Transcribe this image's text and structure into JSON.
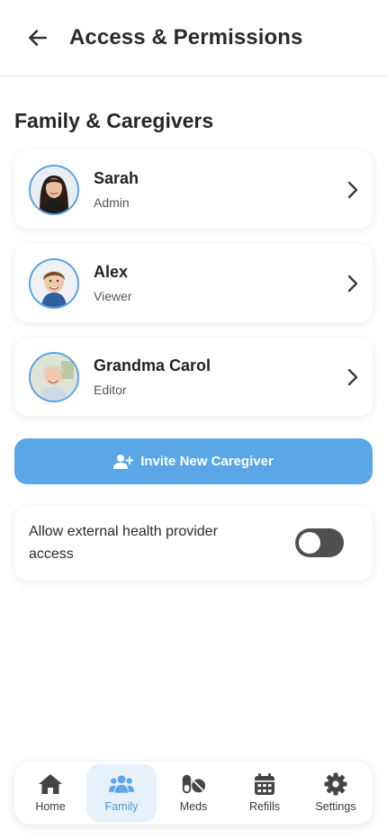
{
  "header": {
    "title": "Access & Permissions",
    "back_icon": "arrow-left-icon"
  },
  "section": {
    "title": "Family & Caregivers"
  },
  "members": [
    {
      "name": "Sarah",
      "role": "Admin",
      "avatar": "woman-dark-hair-photo"
    },
    {
      "name": "Alex",
      "role": "Viewer",
      "avatar": "boy-photo"
    },
    {
      "name": "Grandma Carol",
      "role": "Editor",
      "avatar": "elderly-woman-photo"
    }
  ],
  "invite_button": {
    "label": "Invite New Caregiver",
    "icon": "user-plus-icon"
  },
  "external_access": {
    "label": "Allow external health provider access",
    "enabled": false
  },
  "nav": {
    "items": [
      {
        "label": "Home",
        "icon": "home-icon",
        "active": false
      },
      {
        "label": "Family",
        "icon": "users-icon",
        "active": true
      },
      {
        "label": "Meds",
        "icon": "pills-icon",
        "active": false
      },
      {
        "label": "Refills",
        "icon": "calendar-icon",
        "active": false
      },
      {
        "label": "Settings",
        "icon": "gear-icon",
        "active": false
      }
    ]
  },
  "colors": {
    "accent": "#5aa6e6",
    "active_nav_bg": "#e6f1fb",
    "toggle_off": "#4f4f4f"
  }
}
